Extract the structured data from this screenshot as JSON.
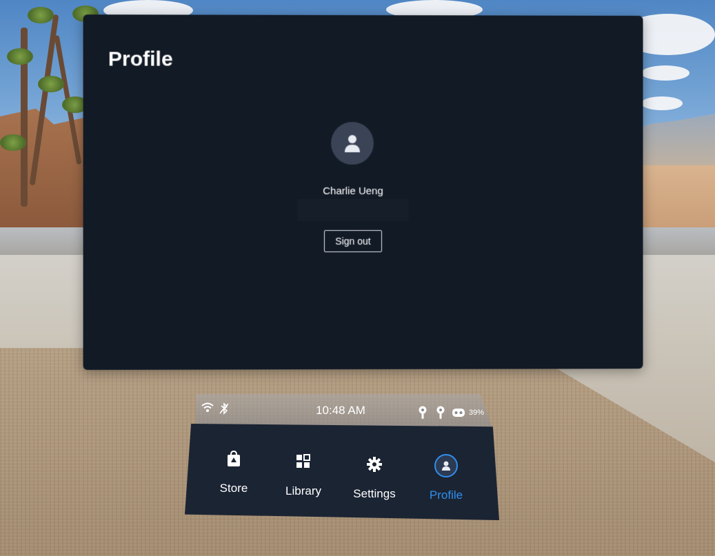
{
  "panel": {
    "title": "Profile",
    "user_name": "Charlie Ueng",
    "sign_out_label": "Sign out"
  },
  "status_bar": {
    "time": "10:48 AM",
    "battery": "39%",
    "icons": [
      "wifi-icon",
      "bluetooth-off-icon",
      "controller-left-icon",
      "controller-right-icon",
      "headset-icon"
    ]
  },
  "dock": {
    "items": [
      {
        "label": "Store",
        "icon": "store-bag-icon"
      },
      {
        "label": "Library",
        "icon": "library-grid-icon"
      },
      {
        "label": "Settings",
        "icon": "gear-icon"
      },
      {
        "label": "Profile",
        "icon": "profile-icon",
        "active": true
      }
    ]
  },
  "colors": {
    "panel_bg": "#121a26",
    "dock_bg": "#1b2433",
    "accent": "#2f8ff0",
    "avatar_bg": "#3a4456"
  }
}
